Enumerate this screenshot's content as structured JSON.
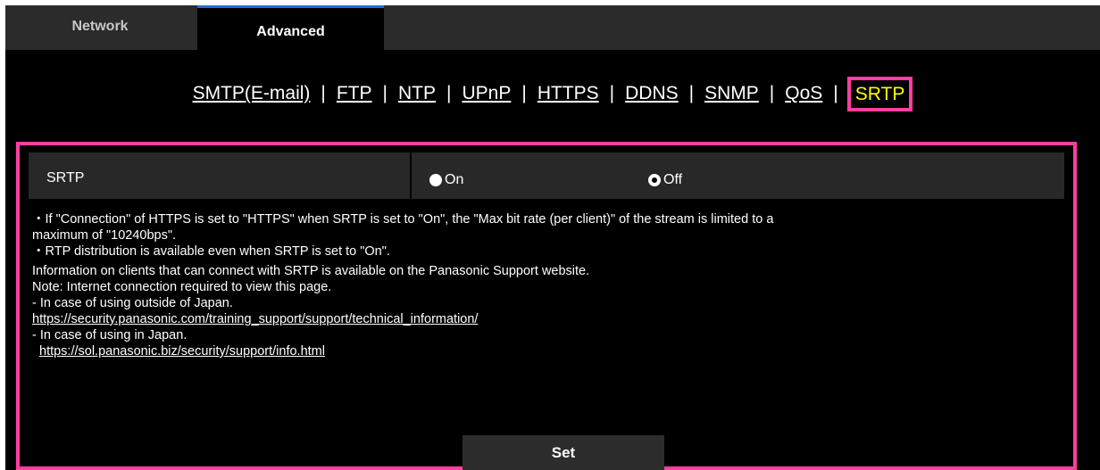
{
  "tabs": [
    {
      "label": "Network",
      "active": false
    },
    {
      "label": "Advanced",
      "active": true
    }
  ],
  "subnav": {
    "items": [
      "SMTP(E-mail)",
      "FTP",
      "NTP",
      "UPnP",
      "HTTPS",
      "DDNS",
      "SNMP",
      "QoS"
    ],
    "current": "SRTP",
    "separator": "|"
  },
  "srtp": {
    "label": "SRTP",
    "options": [
      "On",
      "Off"
    ],
    "selected": "Off"
  },
  "notes": {
    "line1": "・If \"Connection\" of HTTPS is set to \"HTTPS\" when SRTP is set to \"On\", the \"Max bit rate (per client)\" of the stream is limited to a",
    "line2": "maximum of \"10240bps\".",
    "line3": "・RTP distribution is available even when SRTP is set to \"On\".",
    "line4": "Information on clients that can connect with SRTP is available on the Panasonic Support website.",
    "line5": "Note: Internet connection required to view this page.",
    "line6": "- In case of using outside of Japan.",
    "link1": "https://security.panasonic.com/training_support/support/technical_information/",
    "line7": "- In case of using in Japan.",
    "link2": "https://sol.panasonic.biz/security/support/info.html"
  },
  "set_button": "Set",
  "colors": {
    "highlight": "#ff3fa0",
    "current_item": "#ffff00",
    "tab_accent": "#1e6fd1"
  }
}
